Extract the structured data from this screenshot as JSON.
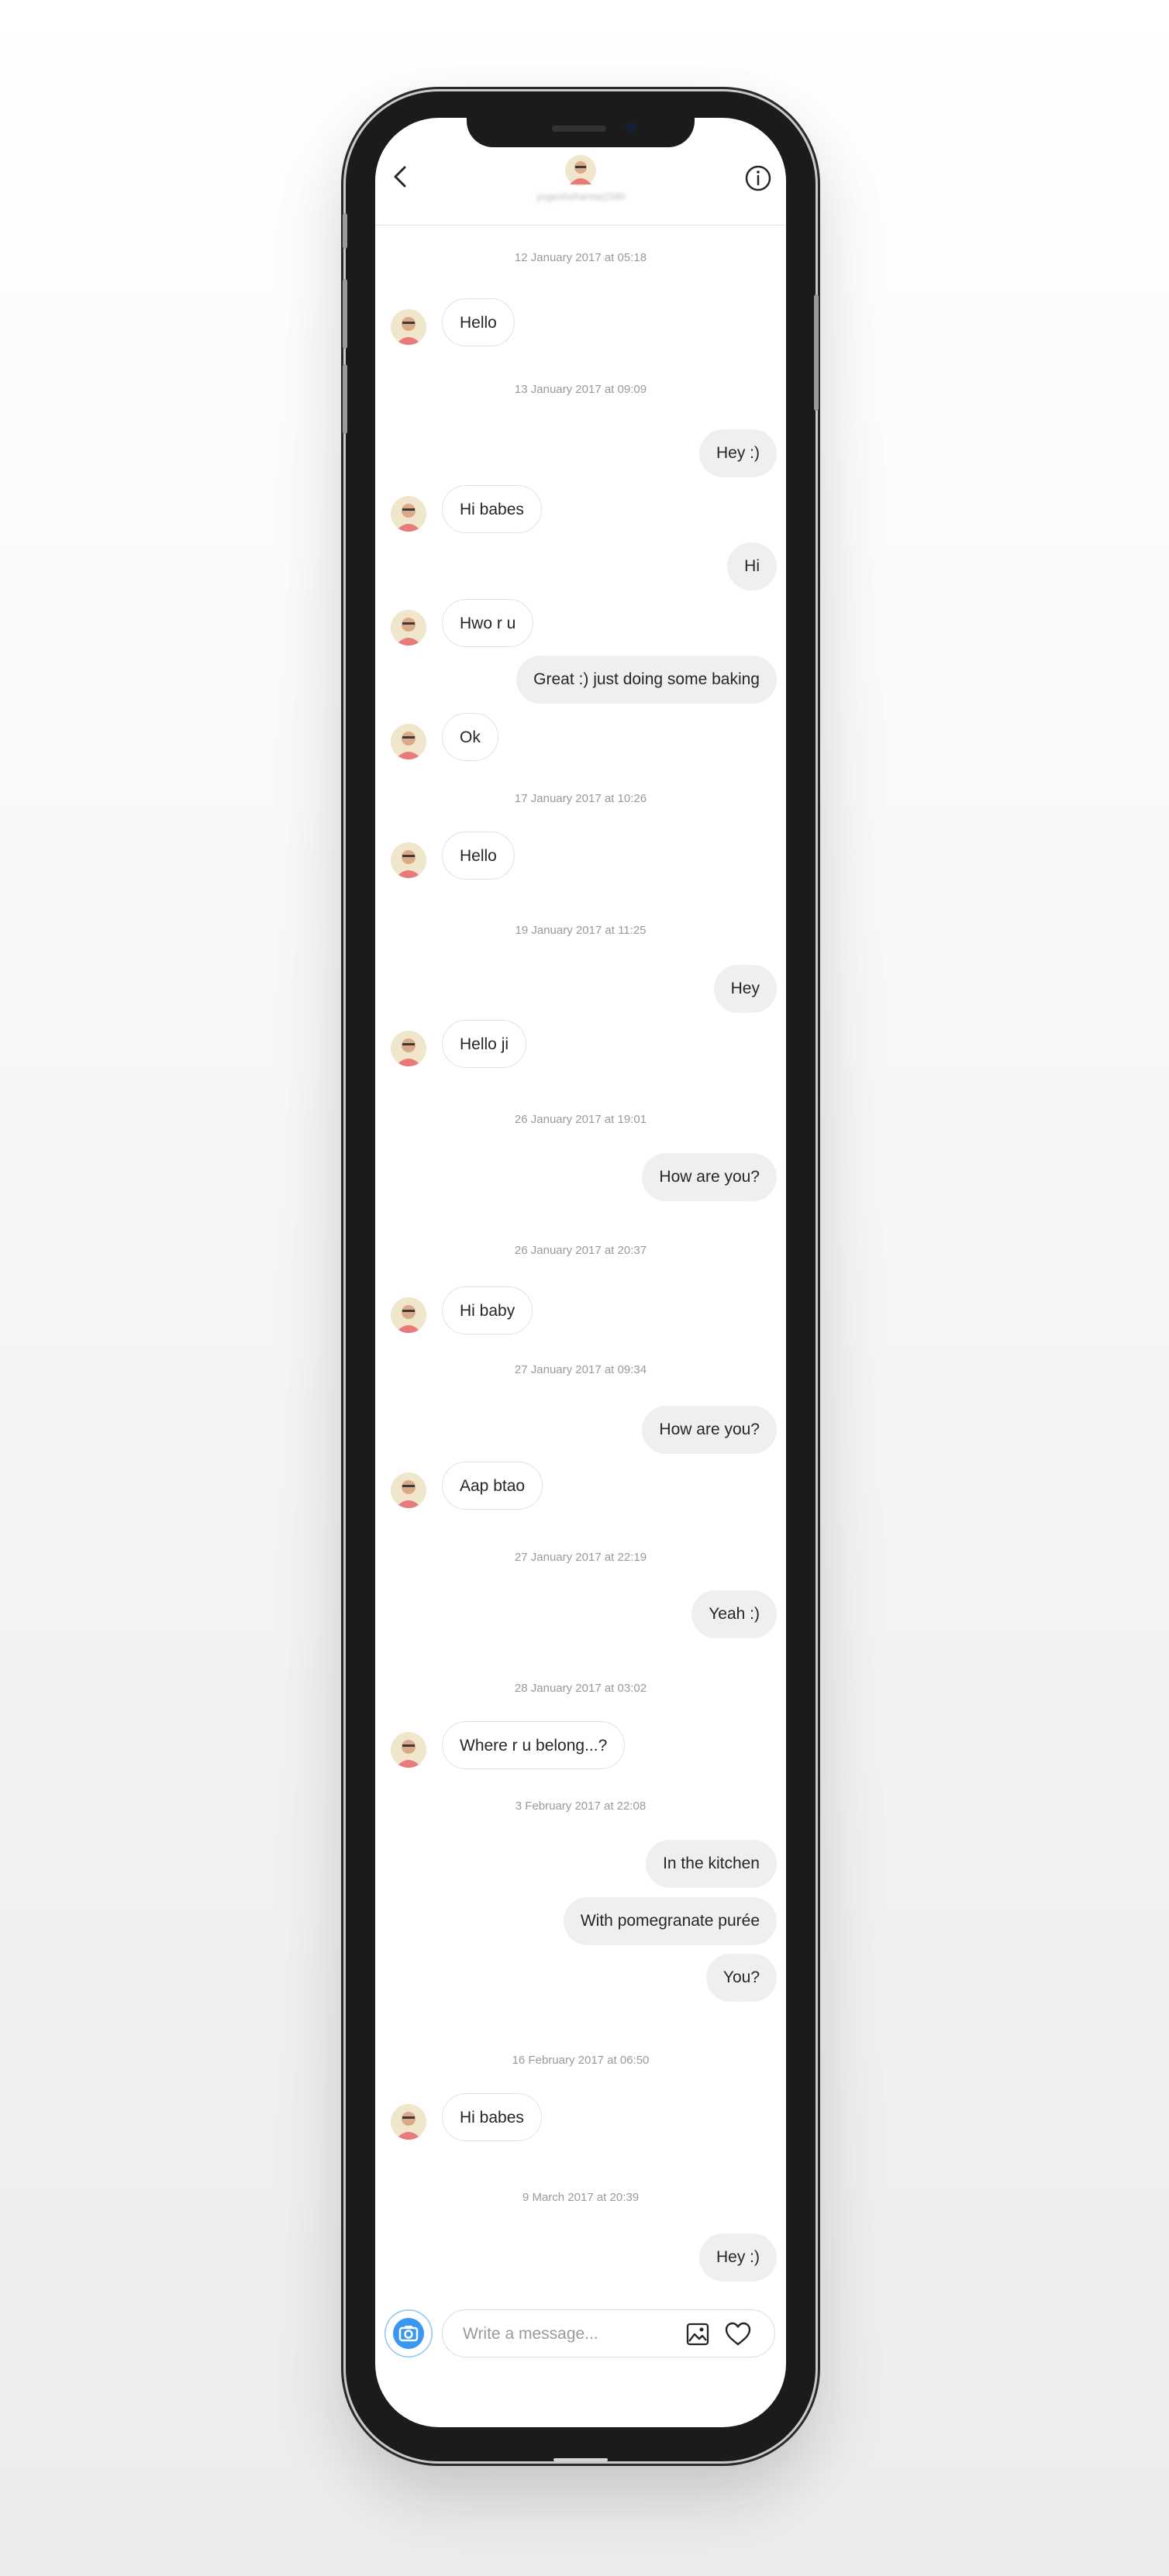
{
  "header": {
    "username": "yogeshsharma1590",
    "back_icon": "chevron-left-icon",
    "info_icon": "info-circle-icon"
  },
  "messages": [
    {
      "kind": "time",
      "text": "12 January 2017 at 05:18"
    },
    {
      "kind": "in",
      "text": "Hello"
    },
    {
      "kind": "time",
      "text": "13 January 2017 at 09:09"
    },
    {
      "kind": "out",
      "text": "Hey :)"
    },
    {
      "kind": "in",
      "text": "Hi babes"
    },
    {
      "kind": "out",
      "text": "Hi"
    },
    {
      "kind": "in",
      "text": "Hwo r u"
    },
    {
      "kind": "out",
      "text": "Great :) just doing some baking"
    },
    {
      "kind": "in",
      "text": "Ok"
    },
    {
      "kind": "time",
      "text": "17 January 2017 at 10:26"
    },
    {
      "kind": "in",
      "text": "Hello"
    },
    {
      "kind": "time",
      "text": "19 January 2017 at 11:25"
    },
    {
      "kind": "out",
      "text": "Hey"
    },
    {
      "kind": "in",
      "text": "Hello ji"
    },
    {
      "kind": "time",
      "text": "26 January 2017 at 19:01"
    },
    {
      "kind": "out",
      "text": "How are you?"
    },
    {
      "kind": "time",
      "text": "26 January 2017 at 20:37"
    },
    {
      "kind": "in",
      "text": "Hi baby"
    },
    {
      "kind": "time",
      "text": "27 January 2017 at 09:34"
    },
    {
      "kind": "out",
      "text": "How are you?"
    },
    {
      "kind": "in",
      "text": "Aap btao"
    },
    {
      "kind": "time",
      "text": "27 January 2017 at 22:19"
    },
    {
      "kind": "out",
      "text": "Yeah :)"
    },
    {
      "kind": "time",
      "text": "28 January 2017 at 03:02"
    },
    {
      "kind": "in",
      "text": "Where r u belong...?"
    },
    {
      "kind": "time",
      "text": "3 February 2017 at 22:08"
    },
    {
      "kind": "out",
      "text": "In the kitchen"
    },
    {
      "kind": "out",
      "text": "With pomegranate purée"
    },
    {
      "kind": "out",
      "text": "You?"
    },
    {
      "kind": "time",
      "text": "16 February 2017 at 06:50"
    },
    {
      "kind": "in",
      "text": "Hi babes"
    },
    {
      "kind": "time",
      "text": "9 March 2017 at 20:39"
    },
    {
      "kind": "out",
      "text": "Hey :)"
    }
  ],
  "composer": {
    "placeholder": "Write a message...",
    "camera_icon": "camera-icon",
    "gallery_icon": "gallery-icon",
    "like_icon": "heart-icon"
  },
  "colors": {
    "accent": "#3897f0",
    "outgoing_bubble": "#efefef",
    "incoming_border": "#e1e1e1",
    "timestamp": "#9a9a9a"
  }
}
